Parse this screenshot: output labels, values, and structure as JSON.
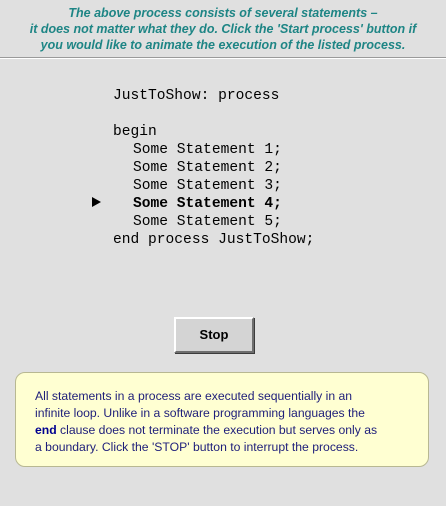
{
  "intro": {
    "lines": [
      "The above process consists of several statements –",
      "it does not matter what they do. Click the 'Start process' button if",
      "you would like to animate the execution of the listed process."
    ]
  },
  "code": {
    "header": "JustToShow: process",
    "begin": "begin",
    "statements": [
      "Some Statement 1;",
      "Some Statement 2;",
      "Some Statement 3;",
      "Some Statement 4;",
      "Some Statement 5;"
    ],
    "active_statement": 4,
    "end": "end process JustToShow;"
  },
  "controls": {
    "stop_label": "Stop"
  },
  "info": {
    "line1": "All statements in a process are executed sequentially in an",
    "line2": "infinite loop. Unlike in a software programming languages the",
    "keyword": "end",
    "line3_rest": " clause does not terminate the execution but serves only as",
    "line4": "a boundary. Click the 'STOP' button to interrupt the process."
  },
  "colors": {
    "intro_text": "#1e8585",
    "background": "#e0e0e0",
    "info_background": "#ffffd2",
    "info_text": "#1e1e7a",
    "keyword": "#000090"
  }
}
